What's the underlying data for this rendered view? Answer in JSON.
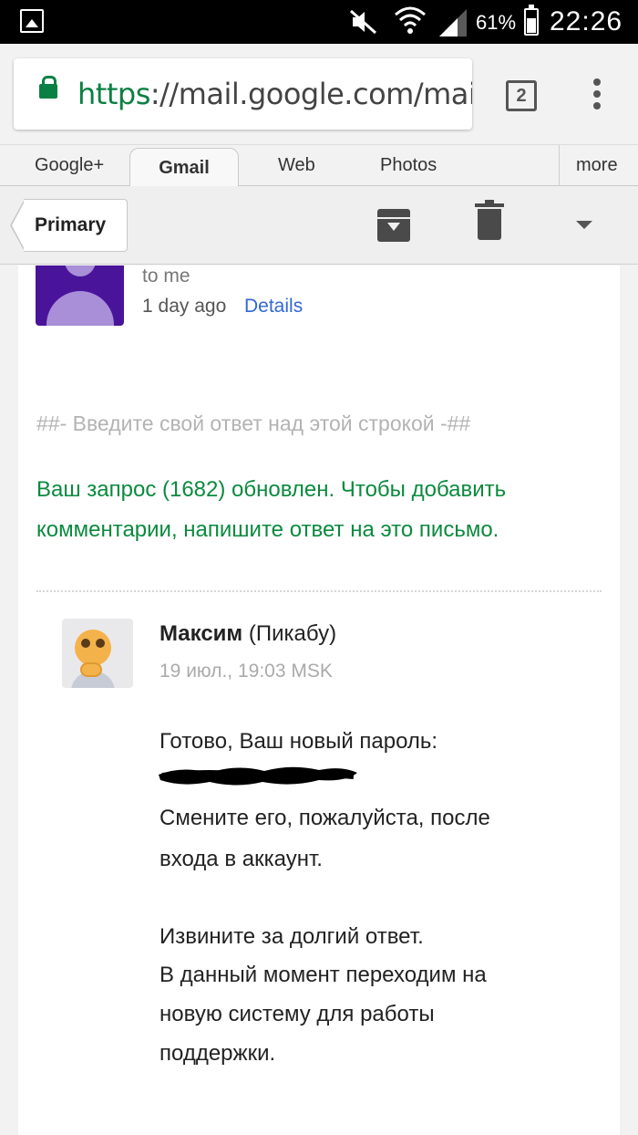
{
  "status_bar": {
    "battery": "61%",
    "time": "22:26"
  },
  "browser": {
    "url_scheme": "https",
    "url_rest": "://mail.google.com/mail/m",
    "tab_count": "2"
  },
  "google_tabs": [
    "Google+",
    "Gmail",
    "Web",
    "Photos",
    "more"
  ],
  "action_bar": {
    "back_label": "Primary"
  },
  "message": {
    "recipient": "to me",
    "date": "1 day ago",
    "details_link": "Details",
    "reply_marker": "##- Введите свой ответ над этой строкой -##",
    "notice_line1": "Ваш запрос (1682) обновлен. Чтобы добавить",
    "notice_line2": "комментарии, напишите ответ на это письмо.",
    "reply": {
      "author": "Максим",
      "author_org": "(Пикабу)",
      "date": "19 июл., 19:03 MSK",
      "line1": "Готово, Ваш новый пароль:",
      "line2": "Смените его, пожалуйста, после",
      "line3": "входа в аккаунт.",
      "line4": "Извините за долгий ответ.",
      "line5": "В данный момент переходим на",
      "line6": "новую систему для работы",
      "line7": "поддержки."
    }
  },
  "colors": {
    "secure_green": "#0b8043",
    "notice_green": "#0b8a3e",
    "link_blue": "#3367d6",
    "avatar_purple": "#4a149a"
  }
}
